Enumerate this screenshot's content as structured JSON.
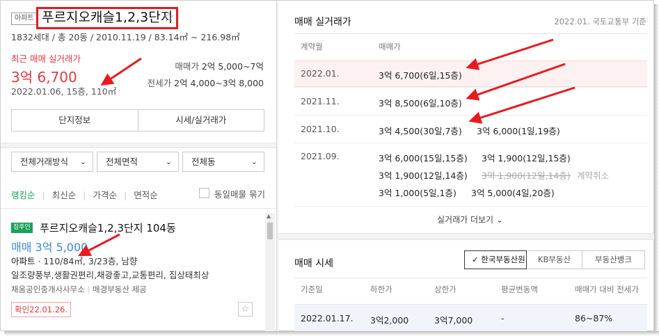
{
  "complex": {
    "type_badge": "아파트",
    "name": "푸르지오캐슬1,2,3단지",
    "meta": "1832세대 / 총 20동 / 2010.11.19 / 83.14㎡ ~ 216.98㎡",
    "recent_label": "최근 매매 실거래가",
    "recent_price": "3억 6,700",
    "recent_date": "2022.01.06, 15층, 110㎡",
    "sale_label": "매매가",
    "sale_range": "2억 5,000~7억",
    "jeonse_label": "전세가",
    "jeonse_range": "2억 4,000~3억 8,000",
    "btn_info": "단지정보",
    "btn_price": "시세/실거래가"
  },
  "filters": {
    "deal": "전체거래방식",
    "area": "전체면적",
    "dong": "전체동"
  },
  "sort": {
    "ranking": "랭킹순",
    "latest": "최신순",
    "price": "가격순",
    "area": "면적순",
    "same_listing": "동일매물 묶기"
  },
  "listing": {
    "badge": "집주인",
    "title": "푸르지오캐슬1,2,3단지 104동",
    "price": "매매 3억 5,000",
    "spec_type": "아파트",
    "spec_rest": " · 110/84㎡, 3/23층, 남향",
    "features": "일조량풍부,생활권편리,채광좋고,교통편리, 집상태최상",
    "agent": "채움공인중개사사무소",
    "provider": "매경부동산 제공",
    "confirmed": "확인22.01.26."
  },
  "transactions": {
    "title": "매매 실거래가",
    "source": "2022.01. 국토교통부 기준",
    "col_month": "계약월",
    "col_price": "매매가",
    "rows": [
      {
        "month": "2022.01.",
        "a": "3억 6,700(6일,15층)"
      },
      {
        "month": "2021.11.",
        "a": "3억 8,500(6일,10층)"
      },
      {
        "month": "2021.10.",
        "a": "3억 4,500(30일,7층)",
        "b": "3억 6,000(1일,19층)"
      },
      {
        "month": "2021.09.",
        "a": "3억 6,000(15일,15층)",
        "b": "3억 1,900(12일,15층)",
        "c": "3억 1,900(12일,14층)",
        "d": "3억 1,900(12일,14층)",
        "d_note": "계약취소",
        "e": "3억 1,000(5일,1층)",
        "f": "3억 5,000(4일,20층)"
      }
    ],
    "more": "실거래가 더보기"
  },
  "market": {
    "title": "매매 시세",
    "tab_kab": "한국부동산원",
    "tab_kb": "KB부동산",
    "tab_bank": "부동산뱅크",
    "col_date": "기준일",
    "col_low": "하한가",
    "col_high": "상한가",
    "col_change": "평균변동액",
    "col_ratio": "매매가 대비 전세가",
    "row": {
      "date": "2022.01.17.",
      "low": "3억2,000",
      "high": "3억7,000",
      "change": "-",
      "ratio": "86~87%"
    }
  },
  "colors": {
    "accent_red": "#e0393e",
    "accent_green": "#1aa05a",
    "accent_blue": "#3d86d8",
    "annotation_red": "#e8191f"
  }
}
